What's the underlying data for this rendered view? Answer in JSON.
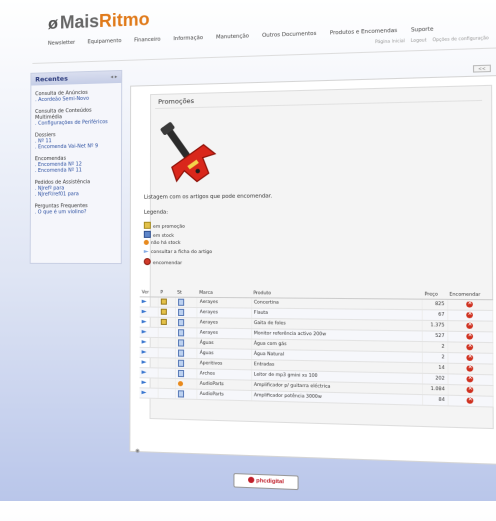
{
  "brand": {
    "part1": "Mais",
    "part2": "Ritmo",
    "logo_mark": "ø"
  },
  "nav": {
    "items": [
      "Newsletter",
      "Equipamento",
      "Financeiro",
      "Informação",
      "Manutenção",
      "Outros Documentos",
      "Produtos e Encomendas",
      "Suporte"
    ]
  },
  "subnav": {
    "items": [
      "Página Inicial",
      "Logout",
      "Opções de configuração"
    ]
  },
  "mini_button_label": "<<",
  "sidebar": {
    "title": "Recentes",
    "controls": "◂ ▸",
    "groups": [
      {
        "title": "Consulta de Anúncios",
        "links": [
          ". Acordeão Semi-Novo"
        ]
      },
      {
        "title": "Consulta de Conteúdos Multimédia",
        "links": [
          ". Configurações de Periféricos"
        ]
      },
      {
        "title": "Dossiers",
        "links": [
          ". Nº 11",
          ". Encomenda Vai-Net Nº 9"
        ]
      },
      {
        "title": "Encomendas",
        "links": [
          ". Encomenda Nº 12",
          ". Encomenda Nº 11"
        ]
      },
      {
        "title": "Pedidos de Assistência",
        "links": [
          ". NJrefº para",
          ". NJrefº/ref01 para"
        ]
      },
      {
        "title": "Perguntas Frequentes",
        "links": [
          ". O que é um violino?"
        ]
      }
    ]
  },
  "main": {
    "title": "Promoções",
    "intro": "Listagem com os artigos que pode encomendar.",
    "legend_title": "Legenda:",
    "legend": [
      {
        "icon": "promo-icon",
        "label": "em promoção"
      },
      {
        "icon": "stock-icon",
        "label": "em stock"
      },
      {
        "icon": "no-stock-icon",
        "label": "não há stock"
      },
      {
        "icon": "view-arrow-icon",
        "label": "consultar a ficha do artigo"
      },
      {
        "icon": "order-icon",
        "label": "encomendar"
      }
    ],
    "table": {
      "headers": [
        "Ver",
        "P",
        "St",
        "Marca",
        "Produto",
        "Preço",
        "Encomendar"
      ],
      "rows": [
        {
          "promo": true,
          "stock": "in",
          "marca": "Aerayes",
          "produto": "Concertina",
          "preco": "825"
        },
        {
          "promo": true,
          "stock": "in",
          "marca": "Aerayes",
          "produto": "Flauta",
          "preco": "67"
        },
        {
          "promo": true,
          "stock": "in",
          "marca": "Aerayes",
          "produto": "Gaita de foles",
          "preco": "1.375"
        },
        {
          "promo": false,
          "stock": "in",
          "marca": "Aerayes",
          "produto": "Monitor referência activo 200w",
          "preco": "527"
        },
        {
          "promo": false,
          "stock": "in",
          "marca": "Águas",
          "produto": "Água com gás",
          "preco": "2"
        },
        {
          "promo": false,
          "stock": "in",
          "marca": "Águas",
          "produto": "Água Natural",
          "preco": "2"
        },
        {
          "promo": false,
          "stock": "in",
          "marca": "Aperitivos",
          "produto": "Entradas",
          "preco": "14"
        },
        {
          "promo": false,
          "stock": "in",
          "marca": "Archos",
          "produto": "Leitor de mp3 gmini xs 100",
          "preco": "202"
        },
        {
          "promo": false,
          "stock": "none",
          "marca": "AudioParts",
          "produto": "Amplificador p/ guitarra eléctrica",
          "preco": "1.084"
        },
        {
          "promo": false,
          "stock": "in",
          "marca": "AudioParts",
          "produto": "Amplificador potência 3000w",
          "preco": "84"
        }
      ]
    }
  },
  "footer": {
    "mark": "◉",
    "badge": "phcdigital"
  },
  "colors": {
    "accent": "#e07a1a",
    "link": "#2a4ea0",
    "order": "#cf3120"
  }
}
